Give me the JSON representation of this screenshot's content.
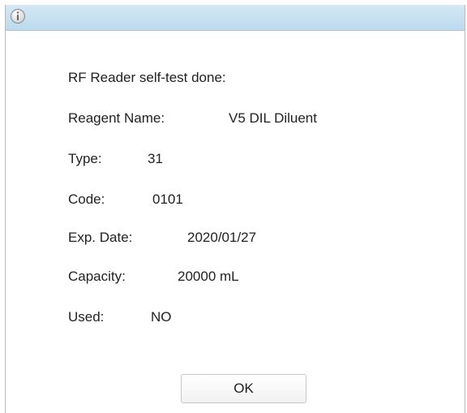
{
  "dialog": {
    "title_icon": "info-icon",
    "heading": "RF Reader self-test done:",
    "fields": {
      "reagent_name": {
        "label": "Reagent Name:",
        "value": "V5 DIL Diluent"
      },
      "type": {
        "label": "Type:",
        "value": "31"
      },
      "code": {
        "label": "Code:",
        "value": "0101"
      },
      "exp_date": {
        "label": "Exp. Date:",
        "value": "2020/01/27"
      },
      "capacity": {
        "label": "Capacity:",
        "value": "20000 mL"
      },
      "used": {
        "label": "Used:",
        "value": "NO"
      }
    },
    "ok_label": "OK"
  },
  "colors": {
    "titlebar": "#c5e0f2",
    "text": "#222222",
    "button_border": "#c7c7c7"
  }
}
